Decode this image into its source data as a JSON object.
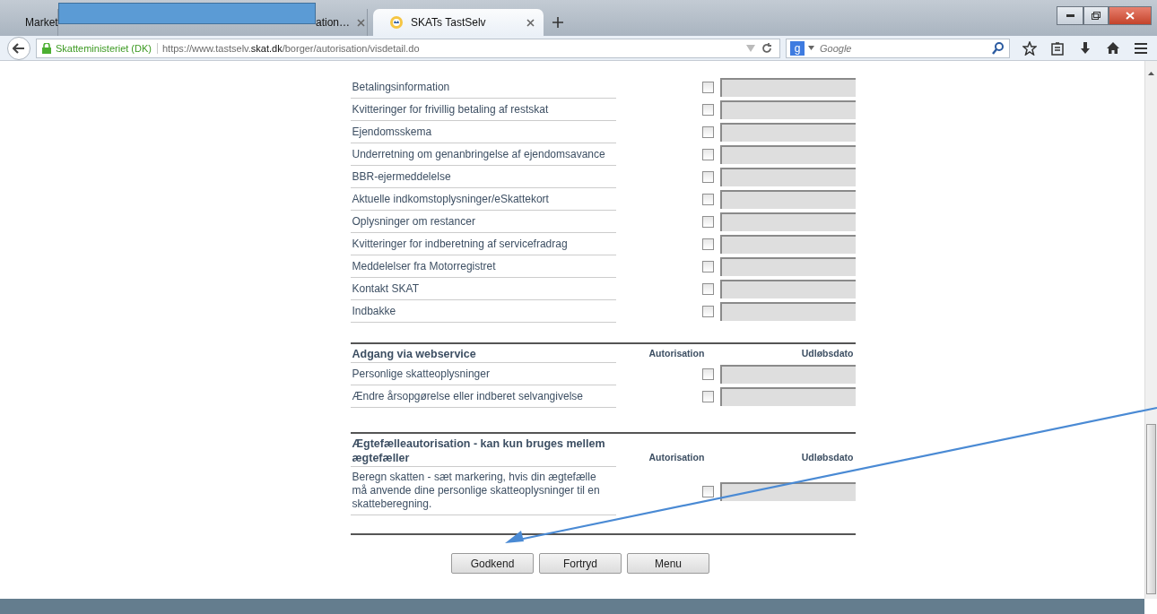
{
  "browser": {
    "tabs": [
      {
        "label": "Market",
        "selected": false
      },
      {
        "label": "ation…",
        "selected": false
      },
      {
        "label": "SKATs TastSelv",
        "selected": true
      }
    ],
    "identity": "Skatteministeriet (DK)",
    "url_prefix": "https://www.tastselv.",
    "url_domain": "skat.dk",
    "url_path": "/borger/autorisation/visdetail.do",
    "search": {
      "logo": "g",
      "placeholder": "Google"
    }
  },
  "sections": [
    {
      "rows": [
        {
          "label": "Betalingsinformation",
          "checked": false
        },
        {
          "label": "Kvitteringer for frivillig betaling af restskat",
          "checked": false
        },
        {
          "label": "Ejendomsskema",
          "checked": false
        },
        {
          "label": "Underretning om genanbringelse af ejendomsavance",
          "checked": false
        },
        {
          "label": "BBR-ejermeddelelse",
          "checked": false
        },
        {
          "label": "Aktuelle indkomstoplysninger/eSkattekort",
          "checked": false
        },
        {
          "label": "Oplysninger om restancer",
          "checked": false
        },
        {
          "label": "Kvitteringer for indberetning af servicefradrag",
          "checked": false
        },
        {
          "label": "Meddelelser fra Motorregistret",
          "checked": false
        },
        {
          "label": "Kontakt SKAT",
          "checked": false
        },
        {
          "label": "Indbakke",
          "checked": false
        }
      ]
    },
    {
      "title": "Adgang via webservice",
      "headers": [
        "Autorisation",
        "Udløbsdato"
      ],
      "rows": [
        {
          "label": "Personlige skatteoplysninger",
          "checked": false
        },
        {
          "label": "Ændre årsopgørelse eller indberet selvangivelse",
          "checked": false
        }
      ]
    },
    {
      "title": "Ægtefælleautorisation - kan kun bruges mellem ægtefæller",
      "headers": [
        "Autorisation",
        "Udløbsdato"
      ],
      "rows": [
        {
          "label": "Beregn skatten - sæt markering, hvis din ægtefælle må anvende dine personlige skatteoplysninger til en skatteberegning.",
          "checked": false
        }
      ]
    }
  ],
  "buttons": [
    "Godkend",
    "Fortryd",
    "Menu"
  ]
}
